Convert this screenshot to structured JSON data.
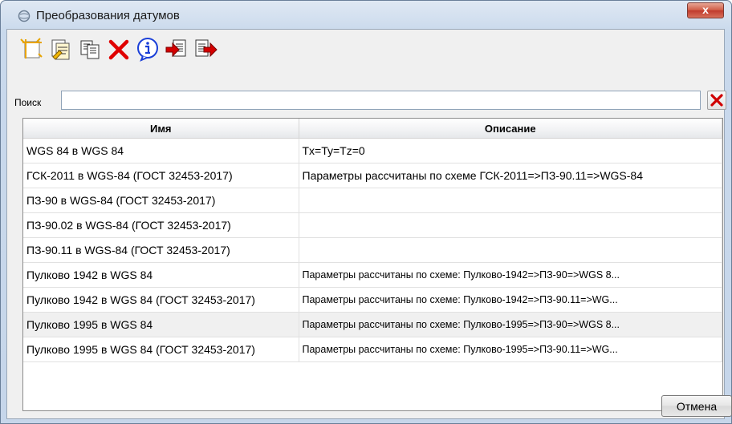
{
  "window": {
    "title": "Преобразования датумов",
    "close_label": "x"
  },
  "toolbar": {
    "buttons": [
      {
        "icon": "new-transform-icon"
      },
      {
        "icon": "edit-transform-icon"
      },
      {
        "icon": "copy-transform-icon"
      },
      {
        "icon": "delete-icon"
      },
      {
        "icon": "info-icon"
      },
      {
        "icon": "import-icon"
      },
      {
        "icon": "export-icon"
      }
    ]
  },
  "search": {
    "label": "Поиск",
    "value": "",
    "clear_icon": "clear-red-x-icon"
  },
  "table": {
    "headers": {
      "name": "Имя",
      "description": "Описание"
    },
    "rows": [
      {
        "name": "WGS 84 в WGS 84",
        "description": "Tx=Ty=Tz=0"
      },
      {
        "name": "ГСК-2011 в WGS-84 (ГОСТ 32453-2017)",
        "description": "Параметры рассчитаны по схеме ГСК-2011=>ПЗ-90.11=>WGS-84"
      },
      {
        "name": "ПЗ-90 в WGS-84 (ГОСТ 32453-2017)",
        "description": ""
      },
      {
        "name": "ПЗ-90.02 в WGS-84 (ГОСТ 32453-2017)",
        "description": ""
      },
      {
        "name": "ПЗ-90.11 в WGS-84 (ГОСТ 32453-2017)",
        "description": ""
      },
      {
        "name": "Пулково 1942 в WGS 84",
        "description": "Параметры рассчитаны по схеме: Пулково-1942=>ПЗ-90=>WGS 8..."
      },
      {
        "name": "Пулково 1942 в WGS 84 (ГОСТ 32453-2017)",
        "description": "Параметры рассчитаны по схеме: Пулково-1942=>ПЗ-90.11=>WG..."
      },
      {
        "name": "Пулково 1995 в WGS 84",
        "description": "Параметры рассчитаны по схеме: Пулково-1995=>ПЗ-90=>WGS 8..."
      },
      {
        "name": "Пулково 1995 в WGS 84 (ГОСТ 32453-2017)",
        "description": "Параметры рассчитаны по схеме: Пулково-1995=>ПЗ-90.11=>WG..."
      }
    ],
    "selected_row_index": 7
  },
  "footer": {
    "cancel_label": "Отмена"
  }
}
